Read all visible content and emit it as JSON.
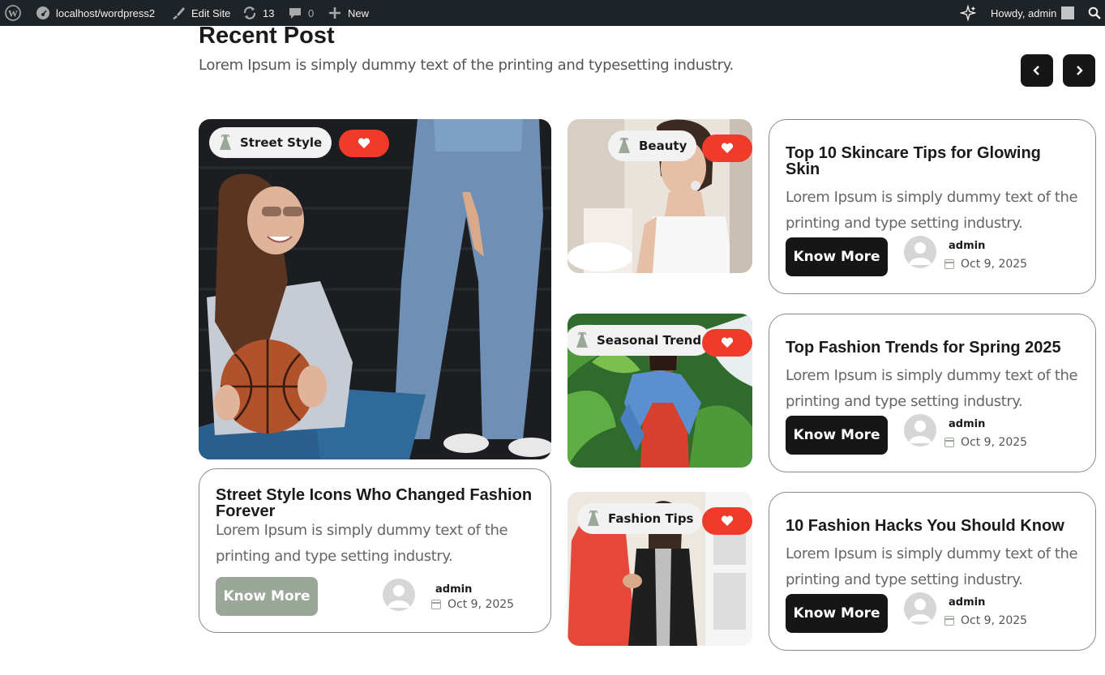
{
  "adminbar": {
    "site": "localhost/wordpress2",
    "edit_site": "Edit Site",
    "updates": "13",
    "comments": "0",
    "new": "New",
    "howdy": "Howdy, admin"
  },
  "section": {
    "title": "Recent Post",
    "subtitle": "Lorem Ipsum is simply dummy text of the printing and typesetting industry."
  },
  "featured": {
    "tag": "Street Style",
    "title_line1": "Street Style Icons Who Changed Fashion",
    "title_line2": "Forever",
    "desc_line1": "Lorem Ipsum is simply dummy text of the",
    "desc_line2": "printing and type setting industry.",
    "button": "Know More",
    "author": "admin",
    "date": "Oct 9, 2025"
  },
  "posts": [
    {
      "tag": "Beauty",
      "title_line1": "Top 10 Skincare Tips for Glowing",
      "title_line2": "Skin",
      "desc_line1": "Lorem Ipsum is simply dummy text of the",
      "desc_line2": "printing and type setting industry.",
      "button": "Know More",
      "author": "admin",
      "date": "Oct 9, 2025"
    },
    {
      "tag": "Seasonal Trend",
      "title_line1": "Top Fashion Trends for Spring 2025",
      "desc_line1": "Lorem Ipsum is simply dummy text of the",
      "desc_line2": "printing and type setting industry.",
      "button": "Know More",
      "author": "admin",
      "date": "Oct 9, 2025"
    },
    {
      "tag": "Fashion Tips",
      "title_line1": "10 Fashion Hacks You Should Know",
      "desc_line1": "Lorem Ipsum is simply dummy text of the",
      "desc_line2": "printing and type setting industry.",
      "button": "Know More",
      "author": "admin",
      "date": "Oct 9, 2025"
    }
  ],
  "colors": {
    "accent_red": "#f03a2a",
    "sage": "#9ba899",
    "dark": "#161616"
  }
}
